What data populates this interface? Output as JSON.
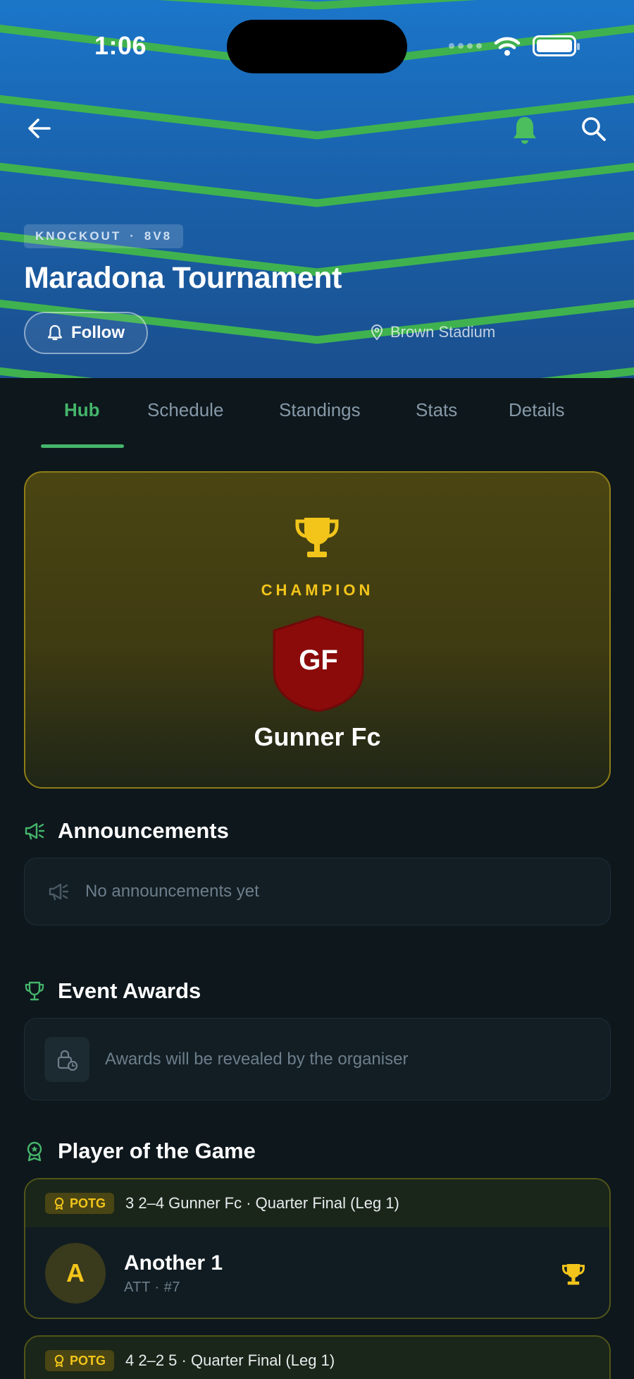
{
  "status_bar": {
    "time": "1:06"
  },
  "header": {
    "chip_format": "KNOCKOUT",
    "chip_separator": "·",
    "chip_size": "8V8",
    "title": "Maradona Tournament",
    "follow_label": "Follow",
    "location": "Brown Stadium"
  },
  "tabs": [
    {
      "label": "Hub",
      "active": true
    },
    {
      "label": "Schedule",
      "active": false
    },
    {
      "label": "Standings",
      "active": false
    },
    {
      "label": "Stats",
      "active": false
    },
    {
      "label": "Details",
      "active": false
    }
  ],
  "champion": {
    "label": "CHAMPION",
    "team_initials": "GF",
    "team_name": "Gunner Fc"
  },
  "announcements": {
    "title": "Announcements",
    "empty_text": "No announcements yet"
  },
  "event_awards": {
    "title": "Event Awards",
    "empty_text": "Awards will be revealed by the organiser"
  },
  "potg": {
    "title": "Player of the Game",
    "cards": [
      {
        "badge": "POTG",
        "match": "3 2–4  Gunner Fc  ·  Quarter Final (Leg 1)",
        "avatar_letter": "A",
        "player_name": "Another 1",
        "player_meta": "ATT  ·  #7"
      },
      {
        "badge": "POTG",
        "match": "4 2–2  5  ·  Quarter Final (Leg 1)"
      }
    ]
  },
  "colors": {
    "accent_green": "#45b56b",
    "gold": "#f3c51b",
    "header_blue": "#1b76c9",
    "shield_red": "#8b0b0b",
    "background": "#0d171c"
  },
  "icons": {
    "back": "arrow-left-icon",
    "bell": "bell-icon",
    "search": "search-icon",
    "location": "location-pin-icon",
    "trophy": "trophy-icon",
    "megaphone": "megaphone-icon",
    "lock": "lock-clock-icon",
    "medal": "medal-icon"
  }
}
